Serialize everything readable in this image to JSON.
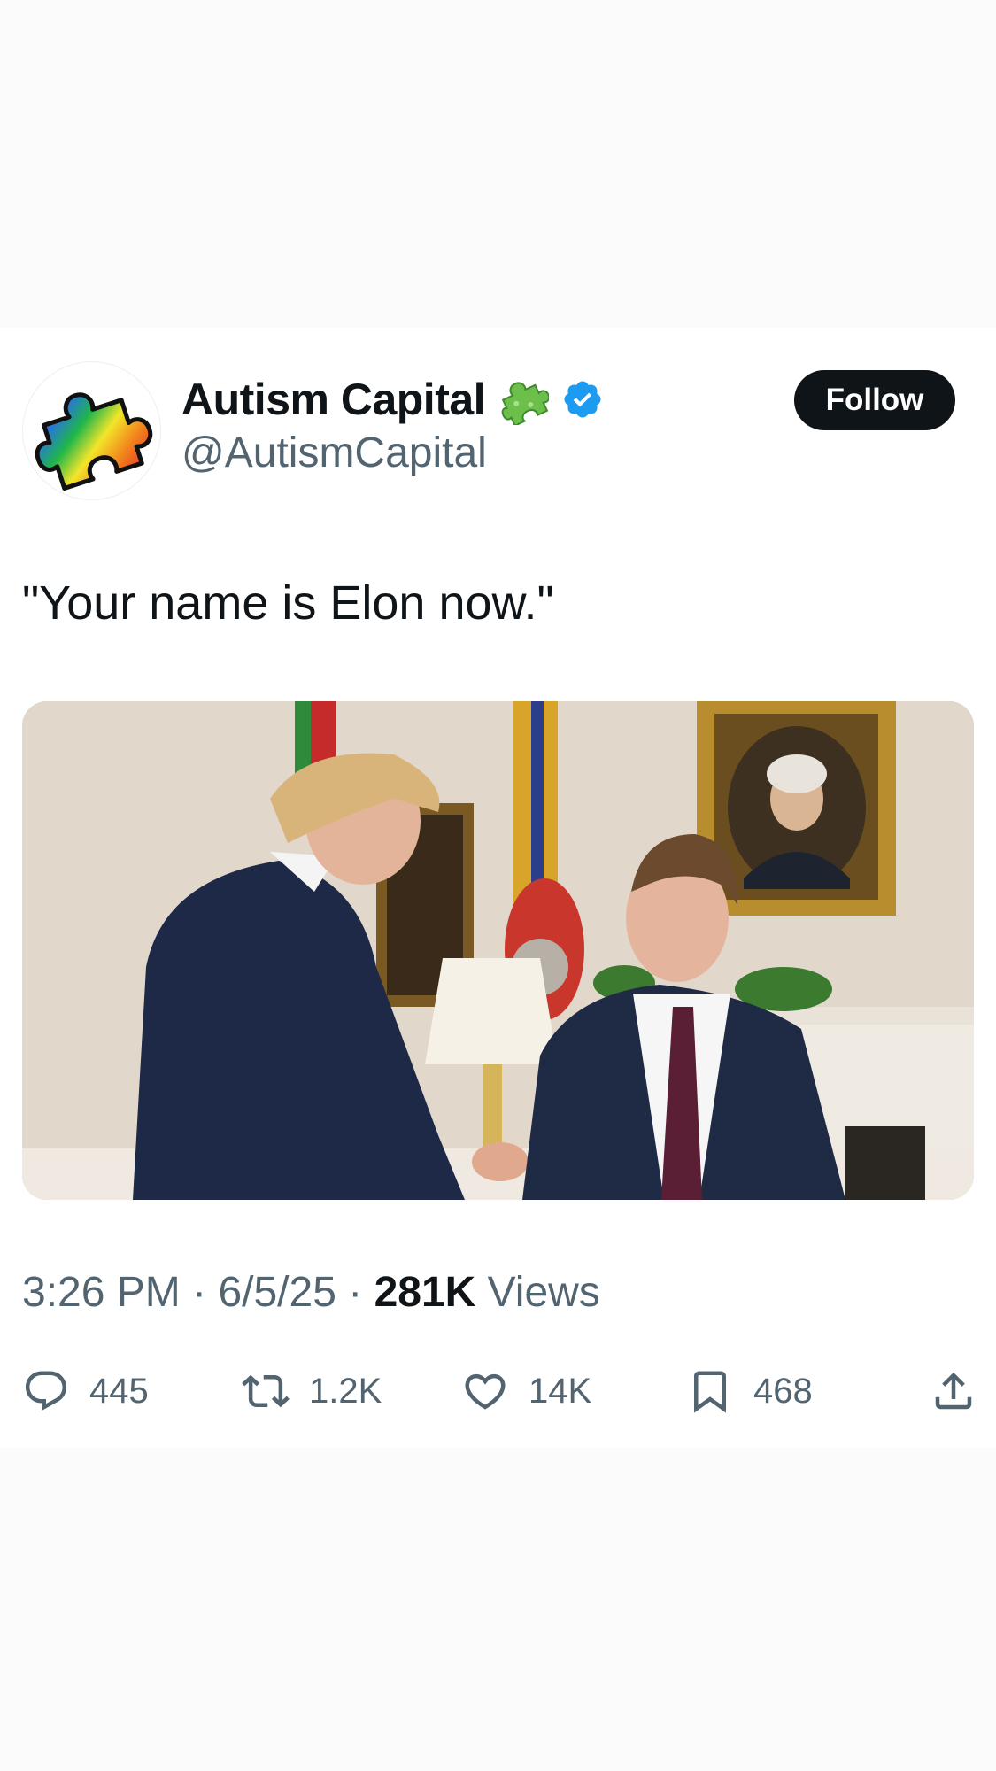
{
  "tweet": {
    "author": {
      "display_name": "Autism Capital",
      "handle": "@AutismCapital",
      "verified": true,
      "avatar_icon": "rainbow-puzzle-piece-icon",
      "name_emoji_icon": "puzzle-piece-icon"
    },
    "follow_label": "Follow",
    "text": "\"Your name is Elon now.\"",
    "media": {
      "icon": "photo-two-men-handshake"
    },
    "meta": {
      "time": "3:26 PM",
      "separator": "·",
      "date": "6/5/25",
      "views_count": "281K",
      "views_label": "Views"
    },
    "actions": {
      "replies": "445",
      "reposts": "1.2K",
      "likes": "14K",
      "bookmarks": "468"
    }
  },
  "colors": {
    "text_primary": "#0f1419",
    "text_secondary": "#536471",
    "verified_blue": "#1d9bf0",
    "follow_bg": "#0f1419"
  }
}
